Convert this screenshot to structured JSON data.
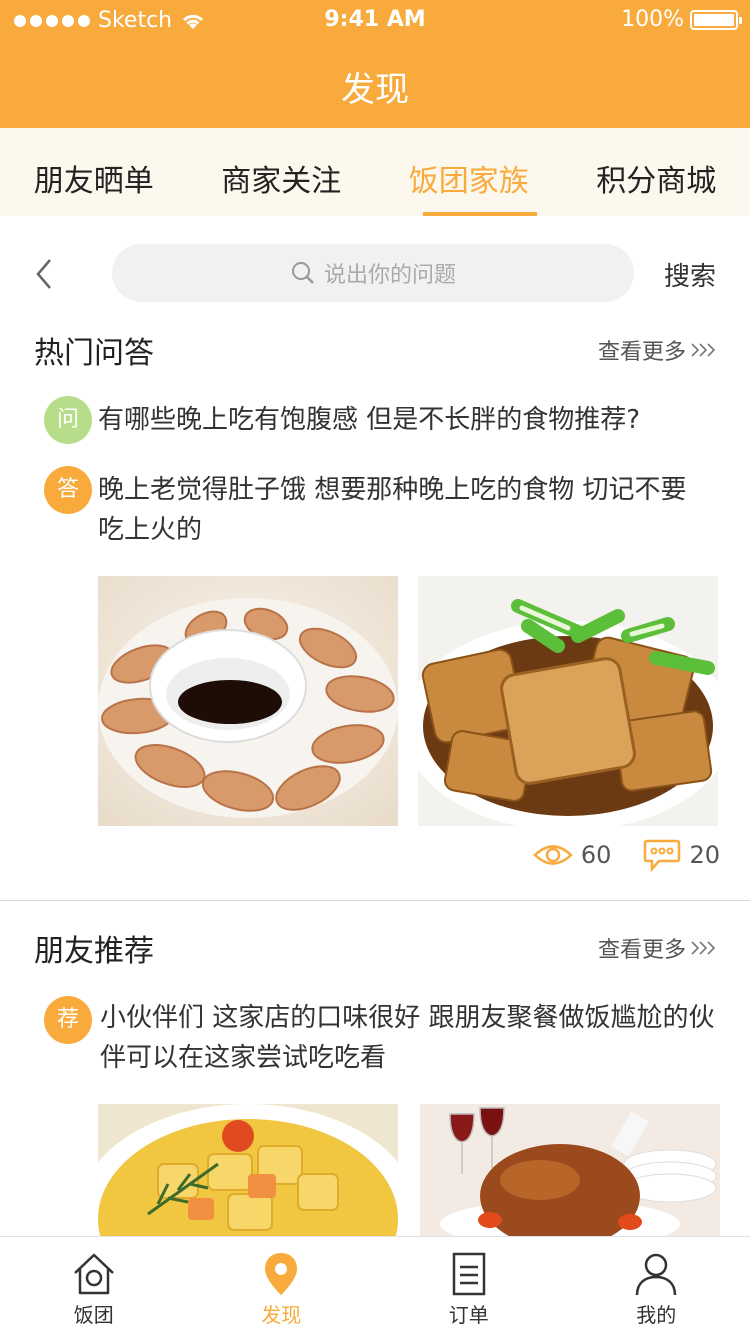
{
  "status_bar": {
    "carrier": "Sketch",
    "time": "9:41 AM",
    "battery": "100%"
  },
  "header": {
    "title": "发现"
  },
  "tabs": [
    {
      "label": "朋友晒单",
      "active": false
    },
    {
      "label": "商家关注",
      "active": false
    },
    {
      "label": "饭团家族",
      "active": true
    },
    {
      "label": "积分商城",
      "active": false
    }
  ],
  "search": {
    "placeholder": "说出你的问题",
    "button_label": "搜索"
  },
  "hot_qa": {
    "title": "热门问答",
    "more_label": "查看更多",
    "question_badge": "问",
    "question": "有哪些晚上吃有饱腹感 但是不长胖的食物推荐?",
    "answer_badge": "答",
    "answer": "晚上老觉得肚子饿 想要那种晚上吃的食物 切记不要吃上火的",
    "views": "60",
    "comments": "20"
  },
  "friend_recommend": {
    "title": "朋友推荐",
    "more_label": "查看更多",
    "badge": "荐",
    "text": "小伙伴们 这家店的口味很好 跟朋友聚餐做饭尴尬的伙伴可以在这家尝试吃吃看"
  },
  "tabbar": [
    {
      "label": "饭团",
      "icon": "house-icon",
      "active": false
    },
    {
      "label": "发现",
      "icon": "location-pin-icon",
      "active": true
    },
    {
      "label": "订单",
      "icon": "order-list-icon",
      "active": false
    },
    {
      "label": "我的",
      "icon": "person-icon",
      "active": false
    }
  ],
  "colors": {
    "accent": "#f8ab3c",
    "question_badge": "#b7dc8a",
    "tab_bg": "#fdf8ee"
  }
}
